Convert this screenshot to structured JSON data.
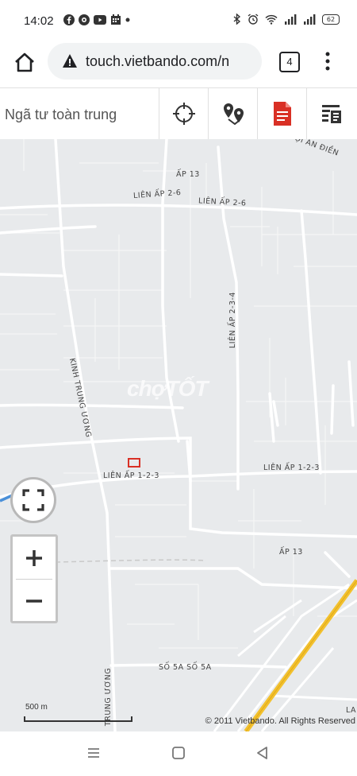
{
  "status_bar": {
    "time": "14:02",
    "battery": "62"
  },
  "browser": {
    "url": "touch.vietbando.com/n",
    "tab_count": "4"
  },
  "toolbar": {
    "search_placeholder": "Ngã tư toàn trung",
    "tools": [
      {
        "icon": "crosshair-icon"
      },
      {
        "icon": "route-pins-icon"
      },
      {
        "icon": "pdf-document-icon",
        "color": "#d93025"
      },
      {
        "icon": "layers-list-icon"
      }
    ]
  },
  "map": {
    "labels": {
      "ap13_top": "ẤP 13",
      "lien_ap_26_left": "LIÊN ẤP 2-6",
      "lien_ap_26_right": "LIÊN ẤP 2-6",
      "lien_ap_234": "LIÊN ẤP 2-3-4",
      "kinh_trung_uong": "KINH TRUNG ƯƠNG",
      "lien_ap_123_left": "LIÊN ẤP 1-2-3",
      "lien_ap_123_right": "LIÊN ẤP 1-2-3",
      "ap13_bottom": "ẤP 13",
      "so_5a": "SỐ 5A SỐ 5A",
      "trung_uong_bottom": "TRUNG ƯƠNG",
      "an_dien": "ỌI AN ĐIỀN",
      "la": "LA"
    },
    "watermark": "chợTỐT",
    "scale": "500 m",
    "copyright": "© 2011 Vietbando. All Rights Reserved",
    "road_color": "#ffffff",
    "highway_color": "#f2c12e",
    "marker_color": "#d93025"
  }
}
